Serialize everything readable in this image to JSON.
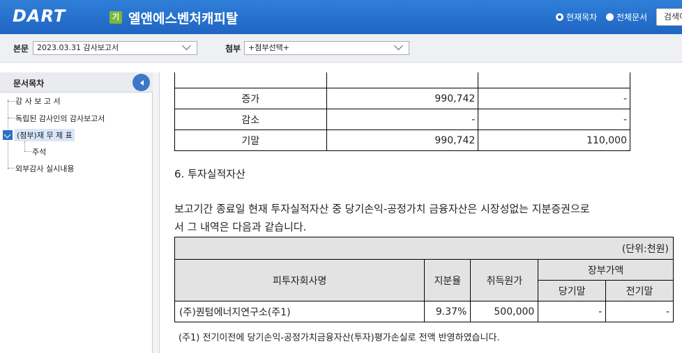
{
  "header": {
    "logo": "DART",
    "badge": "기",
    "company": "엘앤에스벤처캐피탈",
    "radio_current": "현재목차",
    "radio_all": "전체문서",
    "search_button": "검색어"
  },
  "selectors": {
    "main_label": "본문",
    "main_value": "2023.03.31  감사보고서",
    "attach_label": "첨부",
    "attach_value": "+첨부선택+"
  },
  "toc": {
    "title": "문서목차",
    "items": [
      {
        "label": "감 사 보 고 서"
      },
      {
        "label": "독립된 감사인의 감사보고서"
      },
      {
        "label": "(첨부)재 무 제 표"
      },
      {
        "label": "주석"
      },
      {
        "label": "외부감사 실시내용"
      }
    ]
  },
  "table1": {
    "rows": [
      {
        "label": "증가",
        "col1": "990,742",
        "col2": "-"
      },
      {
        "label": "감소",
        "col1": "-",
        "col2": "-"
      },
      {
        "label": "기말",
        "col1": "990,742",
        "col2": "110,000"
      }
    ]
  },
  "section": {
    "heading": "6. 투자실적자산",
    "paragraph_line1": "보고기간 종료일 현재 투자실적자산 중 당기손익-공정가치 금융자산은 시장성없는 지분증권으로",
    "paragraph_line2": "서 그 내역은 다음과 같습니다."
  },
  "table2": {
    "unit": "(단위:천원)",
    "headers": {
      "company": "피투자회사명",
      "share": "지분율",
      "cost": "취득원가",
      "book": "장부가액",
      "current": "당기말",
      "prior": "전기말"
    },
    "rows": [
      {
        "company": "(주)퀀텀에너지연구소(주1)",
        "share": "9.37%",
        "cost": "500,000",
        "current": "-",
        "prior": "-"
      }
    ]
  },
  "note": "(주1) 전기이전에 당기손익-공정가치금융자산(투자)평가손실로 전액 반영하였습니다."
}
